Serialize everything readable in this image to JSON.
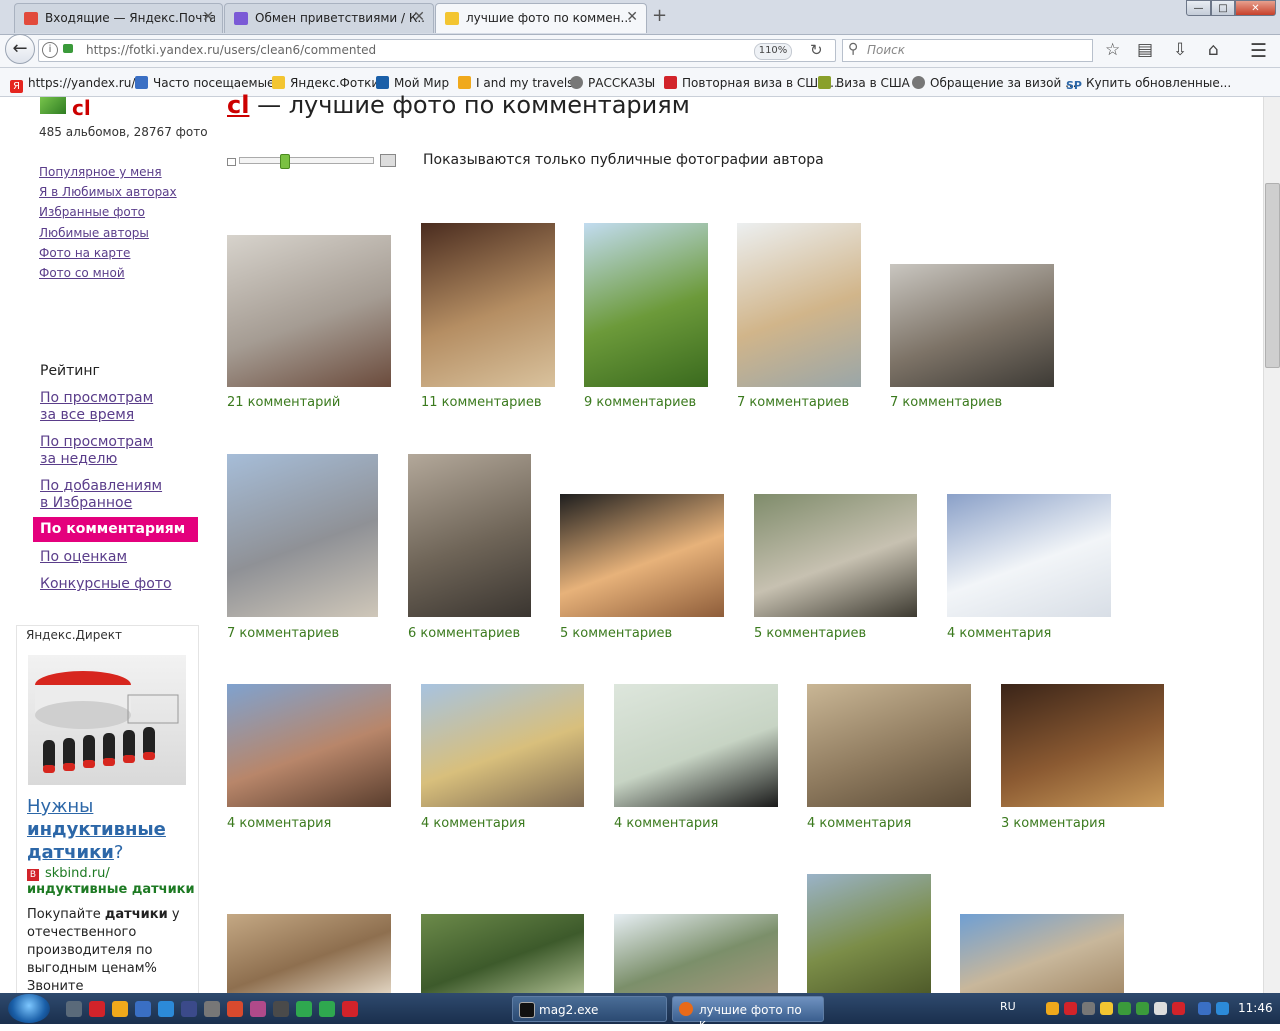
{
  "browser": {
    "tabs": [
      {
        "title": "Входящие — Яндекс.Почта",
        "icon_color": "#e24a3b",
        "active": false
      },
      {
        "title": "Обмен приветствиями / К...",
        "icon_color": "#7b5ad6",
        "active": false
      },
      {
        "title": "лучшие фото по коммен...",
        "icon_color": "#f3c531",
        "active": true
      }
    ],
    "new_tab": "+",
    "window_controls": {
      "minimize": "—",
      "maximize": "□",
      "close": "✕"
    },
    "url": "https://fotki.yandex.ru/users/clean6/commented",
    "zoom": "110%",
    "search_placeholder": "Поиск",
    "bookmarks": [
      {
        "label": "https://yandex.ru/",
        "icon_color": "#e52620"
      },
      {
        "label": "Часто посещаемые",
        "icon_color": "#3a6fc4"
      },
      {
        "label": "Яндекс.Фотки",
        "icon_color": "#f3c531"
      },
      {
        "label": "Мой Мир",
        "icon_color": "#1a5fa8"
      },
      {
        "label": "I and my travels",
        "icon_color": "#f0a91c"
      },
      {
        "label": "РАССКАЗЫ",
        "icon_color": "#777777"
      },
      {
        "label": "Повторная виза в США...",
        "icon_color": "#d2232a"
      },
      {
        "label": "Виза в США",
        "icon_color": "#8aa02b"
      },
      {
        "label": "Обращение за визой ...",
        "icon_color": "#777777"
      },
      {
        "label": "Купить обновленные...",
        "icon_color": "#2c67a8",
        "prefix": "SP"
      }
    ]
  },
  "profile": {
    "name": "cl",
    "stats": "485 альбомов, 28767 фото",
    "links": [
      "Популярное у меня",
      "Я в Любимых авторах",
      "Избранные фото",
      "Любимые авторы",
      "Фото на карте",
      "Фото со мной"
    ]
  },
  "rating": {
    "heading": "Рейтинг",
    "items": [
      {
        "line1": "По просмотрам",
        "line2": "за все время"
      },
      {
        "line1": "По просмотрам",
        "line2": "за неделю"
      },
      {
        "line1": "По добавлениям",
        "line2": "в Избранное"
      },
      {
        "line1": "По комментариям",
        "line2": "",
        "active": true
      },
      {
        "line1": "По оценкам",
        "line2": ""
      },
      {
        "line1": "Конкурсные фото",
        "line2": ""
      }
    ]
  },
  "direct": {
    "label": "Яндекс.Директ",
    "headline_1": "Нужны",
    "headline_2": "индуктивные",
    "headline_3": "датчики",
    "headline_q": "?",
    "site_prefix": "skbind.ru/",
    "site_bold": "индуктивные датчики",
    "body_1": "Покупайте ",
    "body_bold": "датчики",
    "body_2": " у отечественного производителя по выгодным ценам% Звоните"
  },
  "page": {
    "title_name": "cl",
    "title_rest": " — лучшие фото по комментариям",
    "public_note": "Показываются только публичные фотографии автора"
  },
  "photos": [
    {
      "caption": "21 комментарий",
      "colors": [
        "#d7d3cc",
        "#a59c93",
        "#6b4b3c"
      ]
    },
    {
      "caption": "11 комментариев",
      "colors": [
        "#4a2c1f",
        "#b58e63",
        "#d9c29d"
      ]
    },
    {
      "caption": "9 комментариев",
      "colors": [
        "#c2dcf0",
        "#6c9a3a",
        "#3a6a1e"
      ]
    },
    {
      "caption": "7 комментариев",
      "colors": [
        "#eceff0",
        "#d1b58a",
        "#9aa6a8"
      ]
    },
    {
      "caption": "7 комментариев",
      "colors": [
        "#c9c6c0",
        "#7d7367",
        "#3d3a35"
      ]
    },
    {
      "caption": "7 комментариев",
      "colors": [
        "#a6bdd8",
        "#8f9196",
        "#cfc7b9"
      ]
    },
    {
      "caption": "6 комментариев",
      "colors": [
        "#b3a89a",
        "#6f6558",
        "#3a3530"
      ]
    },
    {
      "caption": "5 комментариев",
      "colors": [
        "#1e1e1e",
        "#e7b27a",
        "#8e5d3a"
      ]
    },
    {
      "caption": "5 комментариев",
      "colors": [
        "#7f8c6b",
        "#c7c1b1",
        "#3d3a31"
      ]
    },
    {
      "caption": "4 комментария",
      "colors": [
        "#8aa0c8",
        "#f2f5f8",
        "#d8dee6"
      ]
    },
    {
      "caption": "4 комментария",
      "colors": [
        "#7fa2cf",
        "#b8866a",
        "#5a3e2e"
      ]
    },
    {
      "caption": "4 комментария",
      "colors": [
        "#a7c3e0",
        "#d8bf7c",
        "#7e6a52"
      ]
    },
    {
      "caption": "4 комментария",
      "colors": [
        "#dde6dc",
        "#c7d4c4",
        "#1a1a1a"
      ]
    },
    {
      "caption": "4 комментария",
      "colors": [
        "#c9b695",
        "#8f7b5f",
        "#5b4b37"
      ]
    },
    {
      "caption": "3 комментария",
      "colors": [
        "#3a2418",
        "#8b5a32",
        "#c99a5a"
      ]
    },
    {
      "caption": "",
      "colors": [
        "#c4a884",
        "#8e6f4f",
        "#e0d3c0"
      ]
    },
    {
      "caption": "",
      "colors": [
        "#6c8a4a",
        "#3d5a2b",
        "#a9b98d"
      ]
    },
    {
      "caption": "",
      "colors": [
        "#e6eef3",
        "#7b8f6a",
        "#a5987e"
      ]
    },
    {
      "caption": "",
      "colors": [
        "#9ab3c8",
        "#7b8d48",
        "#4f5b2a"
      ]
    },
    {
      "caption": "",
      "colors": [
        "#6f9fd3",
        "#c8b79b",
        "#a48b6a"
      ]
    }
  ],
  "taskbar": {
    "tasks": [
      "mag2.exe",
      "лучшие фото по к..."
    ],
    "lang": "RU",
    "clock": "11:46",
    "quicklaunch_colors": [
      "#5a6a7a",
      "#d2232a",
      "#f0a91c",
      "#3a6fc4",
      "#2c8ad8",
      "#3b4a8a",
      "#777777",
      "#d84a2e",
      "#b04a8a",
      "#4a4a4a",
      "#2fa84f",
      "#2fa84f",
      "#d2232a"
    ],
    "tray_colors": [
      "#f0a91c",
      "#d2232a",
      "#777777",
      "#f3c531",
      "#3b9b3b",
      "#3b9b3b",
      "#dddddd",
      "#d2232a",
      "#3a6fc4",
      "#2c8ad8"
    ]
  }
}
